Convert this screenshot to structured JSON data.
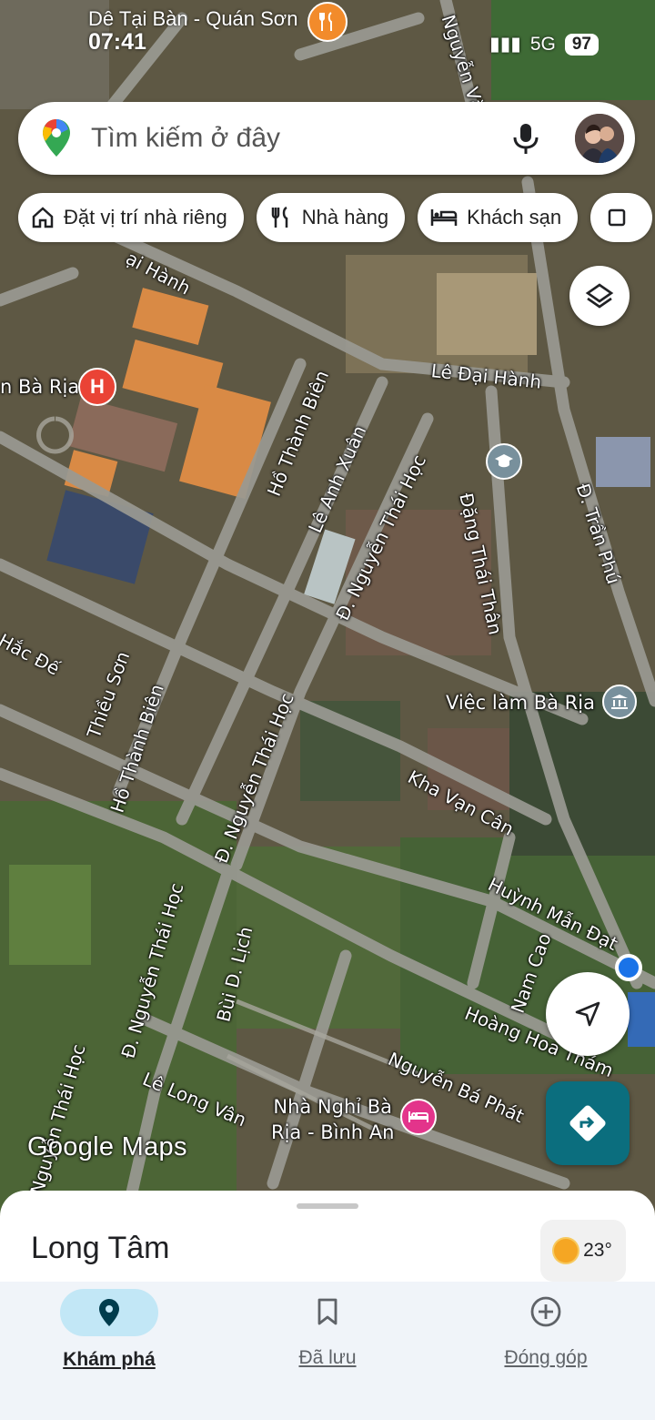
{
  "status_bar": {
    "top_text": "Dê Tại Bàn - Quán Sơn",
    "time": "07:41",
    "network": "5G",
    "battery": "97"
  },
  "search": {
    "placeholder": "Tìm kiếm ở đây",
    "mic_icon": "mic-icon",
    "avatar": "account-avatar"
  },
  "chips": [
    {
      "label": "Đặt vị trí nhà riêng",
      "icon": "home-icon"
    },
    {
      "label": "Nhà hàng",
      "icon": "restaurant-icon"
    },
    {
      "label": "Khách sạn",
      "icon": "hotel-icon"
    }
  ],
  "map": {
    "brand": "Google Maps",
    "road_labels": [
      "Lê Đại Hành",
      "Hồ Thành Biên",
      "Lê Anh Xuân",
      "Đ. Nguyễn Thái Học",
      "Đặng Thái Thân",
      "Đ. Trần Phú",
      "Thiều Sơn",
      "Hồ Thành Biên",
      "Hắc Đế",
      "Đ. Nguyễn Thái Học",
      "Kha Vạn Cân",
      "Huỳnh Mẫn Đạt",
      "Nam Cao",
      "Đ. Nguyễn Thái Học",
      "Bùi D. Lịch",
      "Hoàng Hoa Thám",
      "Nguyễn Bá Phát",
      "Lê Long Vân",
      "Nguyễn Thái Học",
      "Nguyễn Văn",
      "ại Hành"
    ],
    "pois": [
      {
        "label": "n Bà Rịa",
        "icon": "hospital-icon"
      },
      {
        "label": "Việc làm Bà Rịa",
        "icon": "government-icon"
      },
      {
        "label": "Nhà Nghỉ Bà\nRịa - Bình An",
        "icon": "hotel-icon"
      }
    ],
    "top_poi_icon": "restaurant-icon",
    "school_icon": "school-icon",
    "colors": {
      "direction_button": "#0b6e7e",
      "hospital": "#ea4335",
      "hotel": "#e3348b",
      "location": "#1a73e8"
    }
  },
  "sheet": {
    "place_name": "Long Tâm",
    "temperature": "23°",
    "weather_icon": "sun-icon"
  },
  "bottom_nav": [
    {
      "label": "Khám phá",
      "icon": "explore-pin-icon",
      "active": true
    },
    {
      "label": "Đã lưu",
      "icon": "bookmark-icon",
      "active": false
    },
    {
      "label": "Đóng góp",
      "icon": "add-circle-icon",
      "active": false
    }
  ]
}
